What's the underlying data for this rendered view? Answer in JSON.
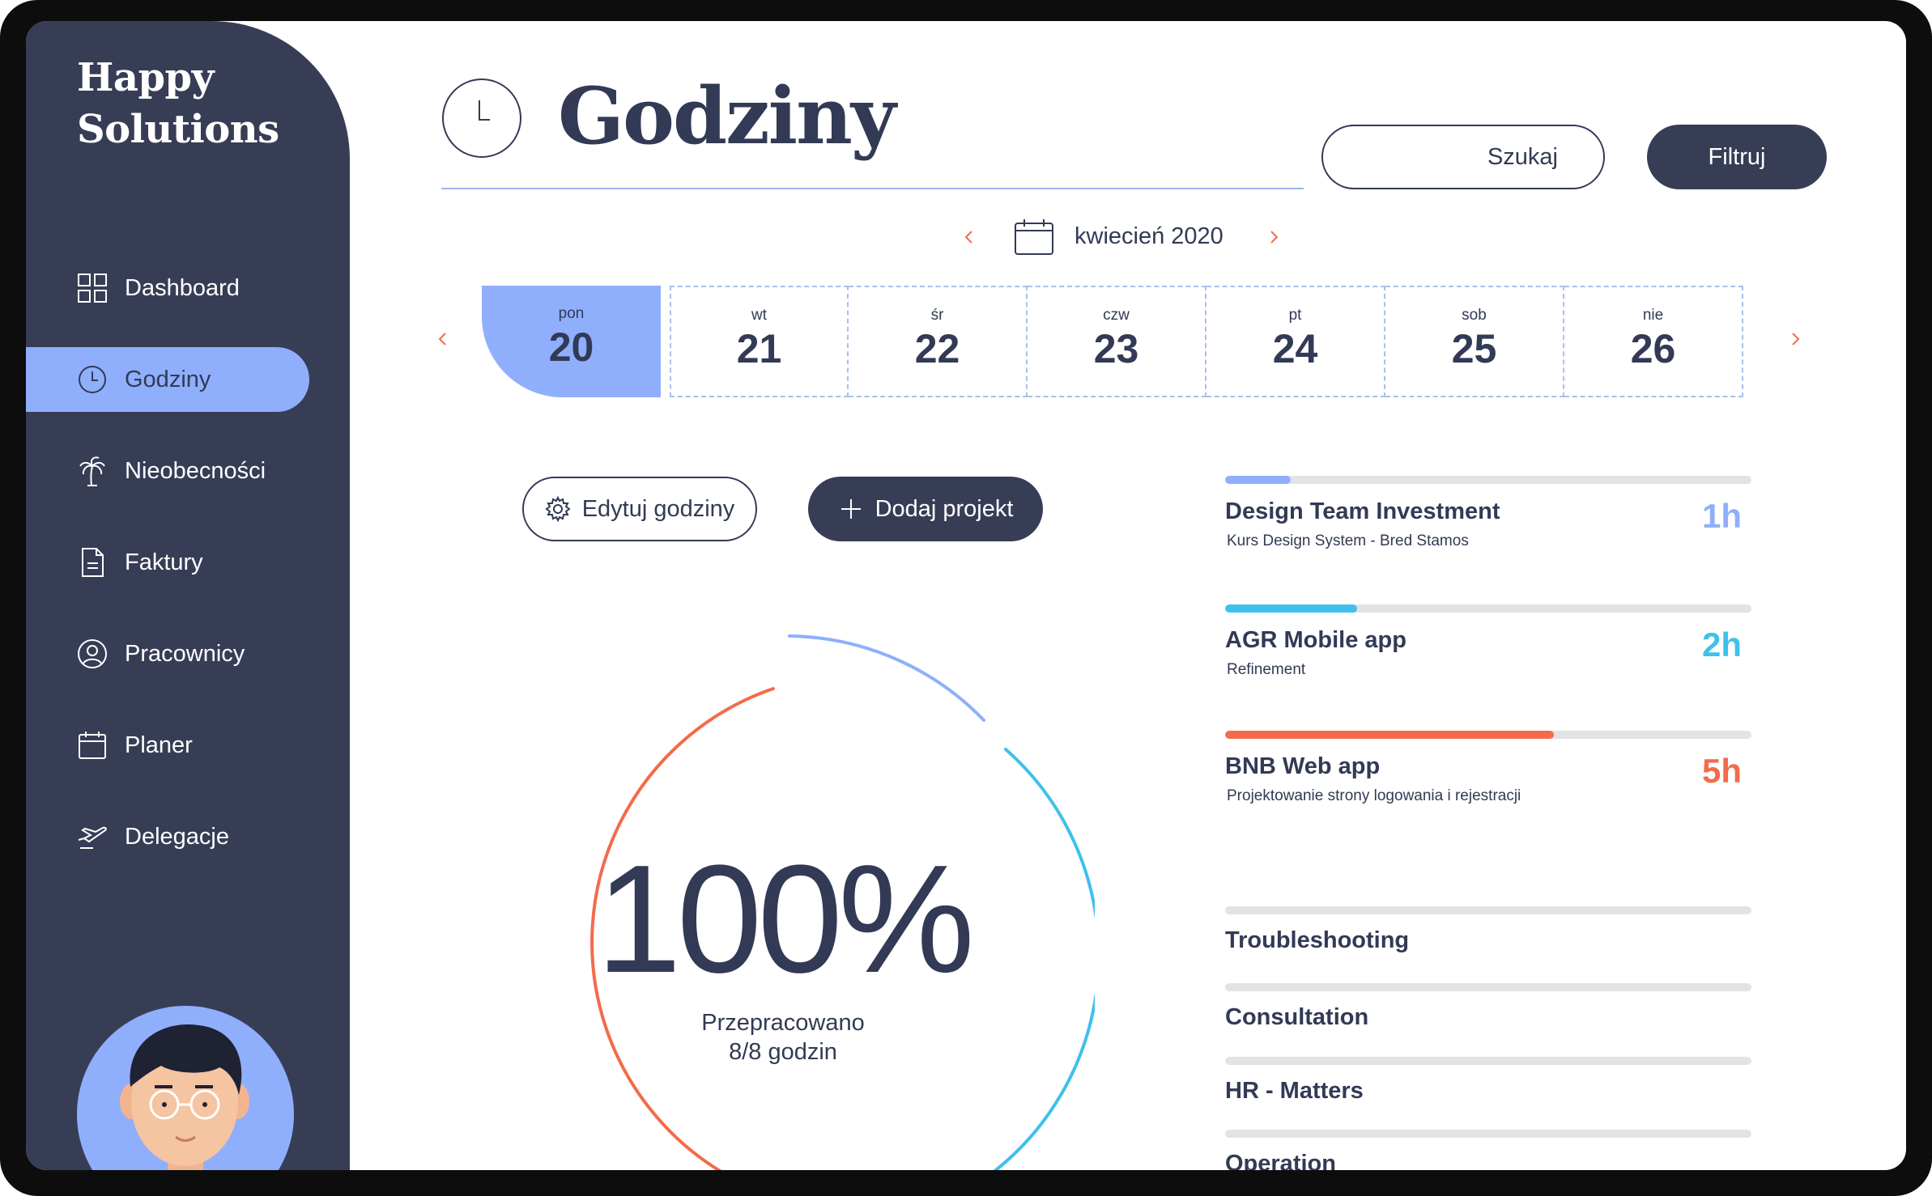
{
  "brand": {
    "line1": "Happy",
    "line2": "Solutions"
  },
  "sidebar": {
    "items": [
      {
        "label": "Dashboard",
        "icon": "grid-icon",
        "active": false
      },
      {
        "label": "Godziny",
        "icon": "clock-icon",
        "active": true
      },
      {
        "label": "Nieobecności",
        "icon": "palm-tree-icon",
        "active": false
      },
      {
        "label": "Faktury",
        "icon": "document-icon",
        "active": false
      },
      {
        "label": "Pracownicy",
        "icon": "user-circle-icon",
        "active": false
      },
      {
        "label": "Planer",
        "icon": "calendar-icon",
        "active": false
      },
      {
        "label": "Delegacje",
        "icon": "airplane-icon",
        "active": false
      }
    ]
  },
  "header": {
    "title": "Godziny",
    "search_label": "Szukaj",
    "filter_label": "Filtruj"
  },
  "month": {
    "label": "kwiecień 2020"
  },
  "week": {
    "days": [
      {
        "name": "pon",
        "num": "20",
        "active": true
      },
      {
        "name": "wt",
        "num": "21",
        "active": false
      },
      {
        "name": "śr",
        "num": "22",
        "active": false
      },
      {
        "name": "czw",
        "num": "23",
        "active": false
      },
      {
        "name": "pt",
        "num": "24",
        "active": false
      },
      {
        "name": "sob",
        "num": "25",
        "active": false
      },
      {
        "name": "nie",
        "num": "26",
        "active": false
      }
    ]
  },
  "actions": {
    "edit_label": "Edytuj godziny",
    "add_label": "Dodaj projekt"
  },
  "summary": {
    "percent": "100%",
    "line1": "Przepracowano",
    "line2": "8/8 godzin"
  },
  "projects": [
    {
      "name": "Design Team Investment",
      "desc": "Kurs Design System - Bred Stamos",
      "hours": "1h",
      "color": "#8faffd",
      "fill": 0.125
    },
    {
      "name": "AGR Mobile app",
      "desc": "Refinement",
      "hours": "2h",
      "color": "#3fc0ec",
      "fill": 0.25
    },
    {
      "name": "BNB Web app",
      "desc": "Projektowanie strony logowania i rejestracji",
      "hours": "5h",
      "color": "#f36b4b",
      "fill": 0.625
    }
  ],
  "tasks": [
    {
      "name": "Troubleshooting"
    },
    {
      "name": "Consultation"
    },
    {
      "name": "HR - Matters"
    },
    {
      "name": "Operation"
    }
  ],
  "colors": {
    "navy": "#383d56",
    "accent": "#8faffd",
    "blue": "#3fc0ec",
    "orange": "#f36b4b"
  }
}
